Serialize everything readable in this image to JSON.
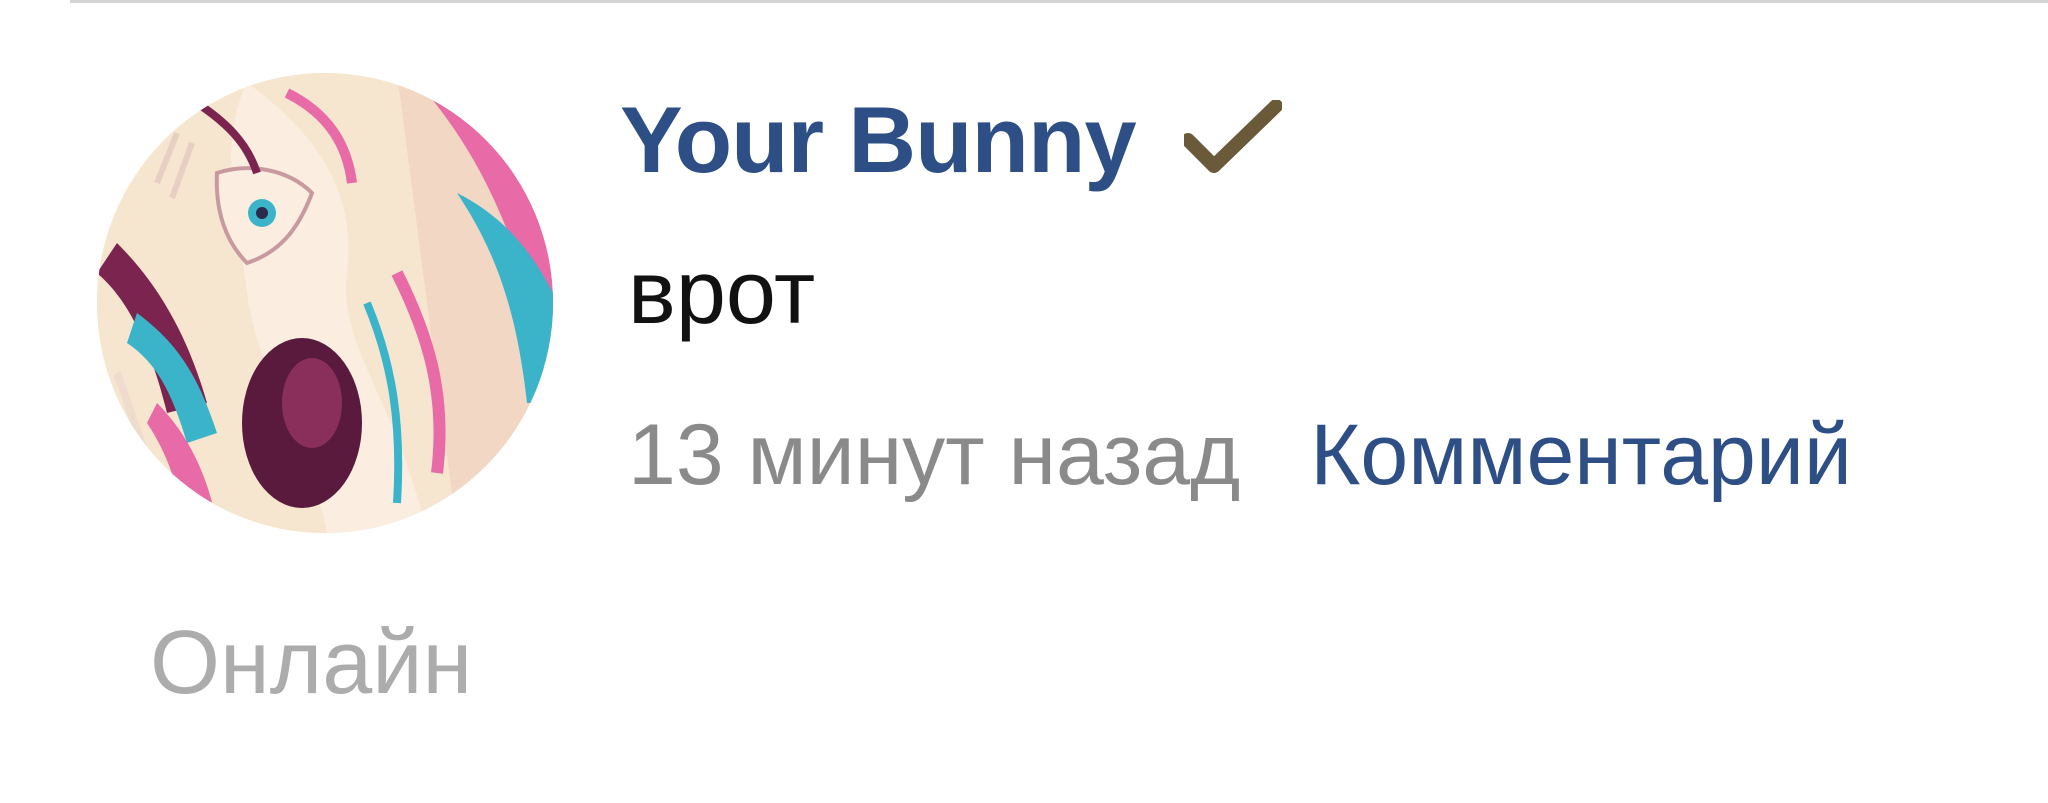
{
  "comment": {
    "author": {
      "name": "Your Bunny",
      "verified": true,
      "verified_icon": "checkmark-icon",
      "name_color": "#2d4f86",
      "checkmark_color": "#6b5a3a"
    },
    "text": "врот",
    "timestamp": "13 минут назад",
    "reply_label": "Комментарий",
    "status": "Онлайн"
  },
  "colors": {
    "link": "#2d4f86",
    "muted": "#8a8a8a",
    "status": "#acacac",
    "text": "#111111"
  }
}
